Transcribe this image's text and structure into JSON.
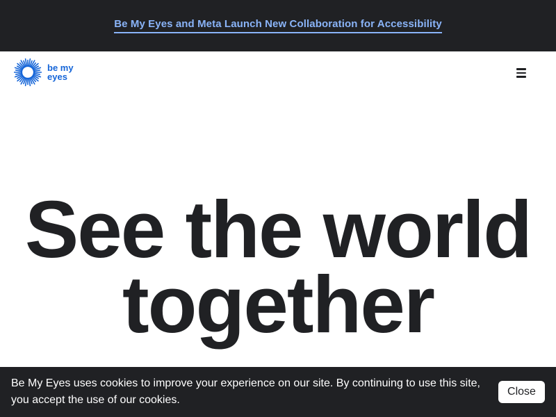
{
  "announcement": {
    "text": "Be My Eyes and Meta Launch New Collaboration for Accessibility"
  },
  "header": {
    "logo_line1": "be my",
    "logo_line2": "eyes",
    "menu_icon": "hamburger-menu-icon",
    "brand_color": "#1565d8"
  },
  "hero": {
    "line1": "See the world",
    "line2": "together"
  },
  "cookie_banner": {
    "message": "Be My Eyes uses cookies to improve your experience on our site. By continuing to use this site, you accept the use of our cookies.",
    "close_label": "Close"
  },
  "colors": {
    "dark_background": "#202124",
    "link": "#8ab4f8",
    "text": "#202124"
  }
}
